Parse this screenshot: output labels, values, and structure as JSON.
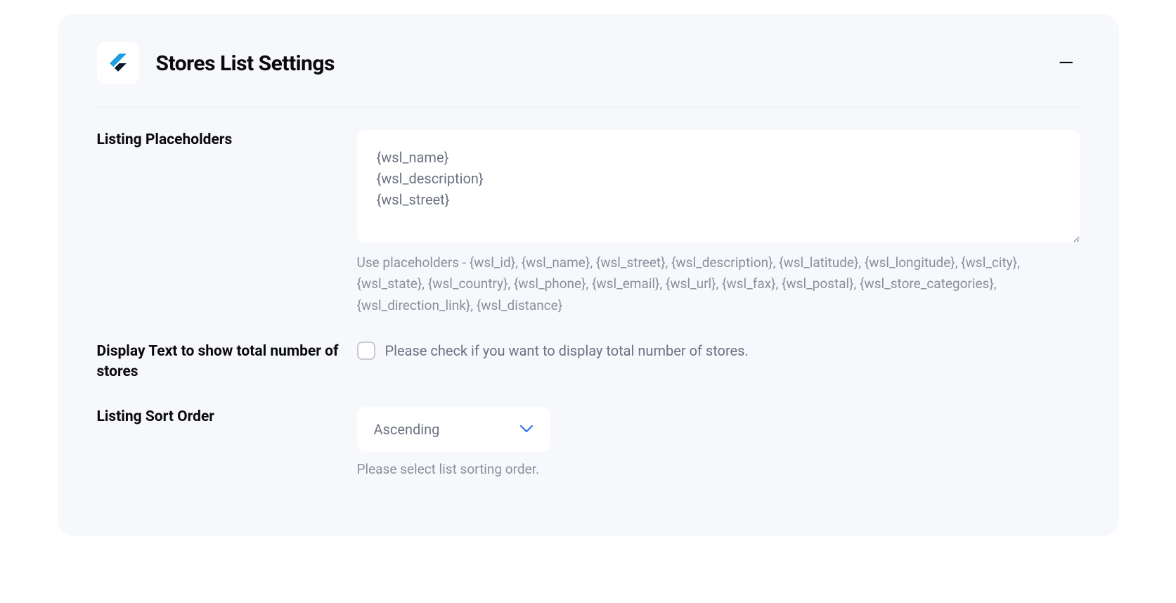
{
  "panel": {
    "title": "Stores List Settings"
  },
  "fields": {
    "placeholders": {
      "label": "Listing Placeholders",
      "value": "{wsl_name}\n{wsl_description}\n{wsl_street}",
      "help": "Use placeholders - {wsl_id}, {wsl_name}, {wsl_street}, {wsl_description}, {wsl_latitude}, {wsl_longitude}, {wsl_city}, {wsl_state}, {wsl_country}, {wsl_phone}, {wsl_email}, {wsl_url}, {wsl_fax}, {wsl_postal}, {wsl_store_categories}, {wsl_direction_link}, {wsl_distance}"
    },
    "display_total": {
      "label": "Display Text to show total number of stores",
      "checkbox_label": "Please check if you want to display total number of stores.",
      "checked": false
    },
    "sort_order": {
      "label": "Listing Sort Order",
      "value": "Ascending",
      "help": "Please select list sorting order."
    }
  }
}
